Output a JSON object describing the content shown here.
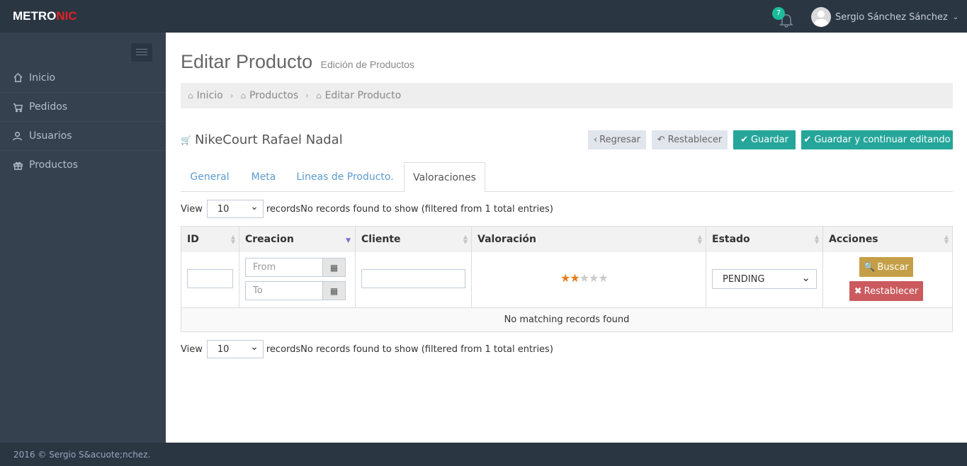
{
  "header": {
    "logo_main": "METRO",
    "logo_accent": "NIC",
    "notification_count": "7",
    "user_name": "Sergio Sánchez Sánchez"
  },
  "sidebar": {
    "items": [
      {
        "label": "Inicio",
        "icon": "home-icon"
      },
      {
        "label": "Pedidos",
        "icon": "cart-icon"
      },
      {
        "label": "Usuarios",
        "icon": "users-icon"
      },
      {
        "label": "Productos",
        "icon": "gift-icon"
      }
    ]
  },
  "page": {
    "title": "Editar Producto",
    "subtitle": "Edición de Productos"
  },
  "breadcrumb": [
    "Inicio",
    "Productos",
    "Editar Producto"
  ],
  "product": {
    "name": "NikeCourt Rafael Nadal"
  },
  "actions": {
    "back": "Regresar",
    "reset": "Restablecer",
    "save": "Guardar",
    "save_continue": "Guardar y continuar editando"
  },
  "tabs": [
    "General",
    "Meta",
    "Lineas de Producto.",
    "Valoraciones"
  ],
  "active_tab": "Valoraciones",
  "view": {
    "label": "View",
    "page_size": "10",
    "info": "recordsNo records found to show (filtered from 1 total entries)"
  },
  "table": {
    "columns": [
      "ID",
      "Creacion",
      "Cliente",
      "Valoración",
      "Estado",
      "Acciones"
    ],
    "filters": {
      "from_placeholder": "From",
      "to_placeholder": "To",
      "rating": 2,
      "rating_max": 5,
      "estado": "PENDING",
      "search_button": "Buscar",
      "reset_button": "Restablecer"
    },
    "empty_message": "No matching records found"
  },
  "footer": {
    "text": "2016 © Sergio S&acuote;nchez."
  },
  "colors": {
    "header_bg": "#2b3643",
    "sidebar_bg": "#364150",
    "accent_red": "#e02222",
    "green_button": "#26a69a",
    "yellow_button": "#c49f47",
    "red_button": "#cb5a5e",
    "star_on": "#e67e22"
  }
}
